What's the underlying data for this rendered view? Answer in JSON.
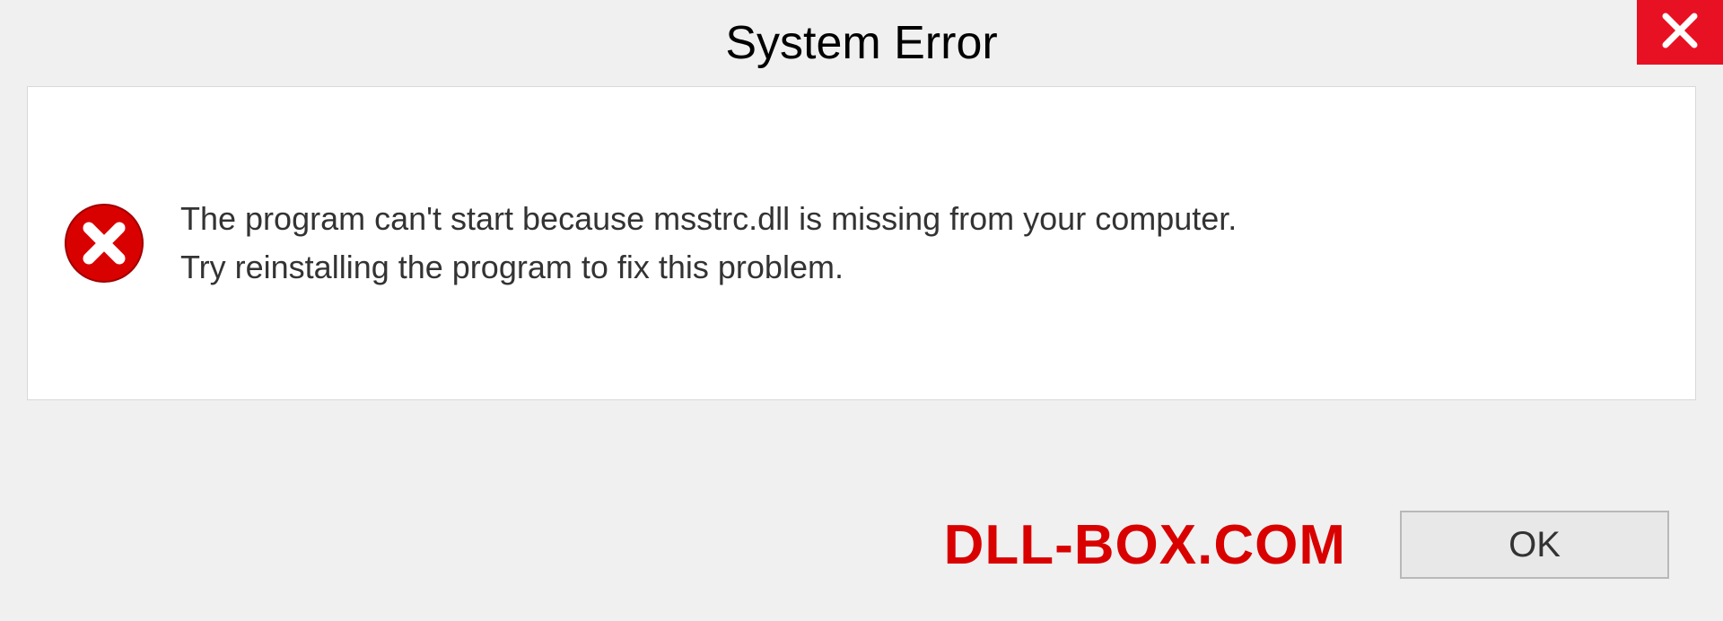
{
  "titlebar": {
    "title": "System Error"
  },
  "message": {
    "line1": "The program can't start because msstrc.dll is missing from your computer.",
    "line2": "Try reinstalling the program to fix this problem."
  },
  "footer": {
    "watermark": "DLL-BOX.COM",
    "ok_label": "OK"
  },
  "colors": {
    "close_bg": "#e81123",
    "error_icon": "#d90000",
    "watermark": "#d90000"
  }
}
